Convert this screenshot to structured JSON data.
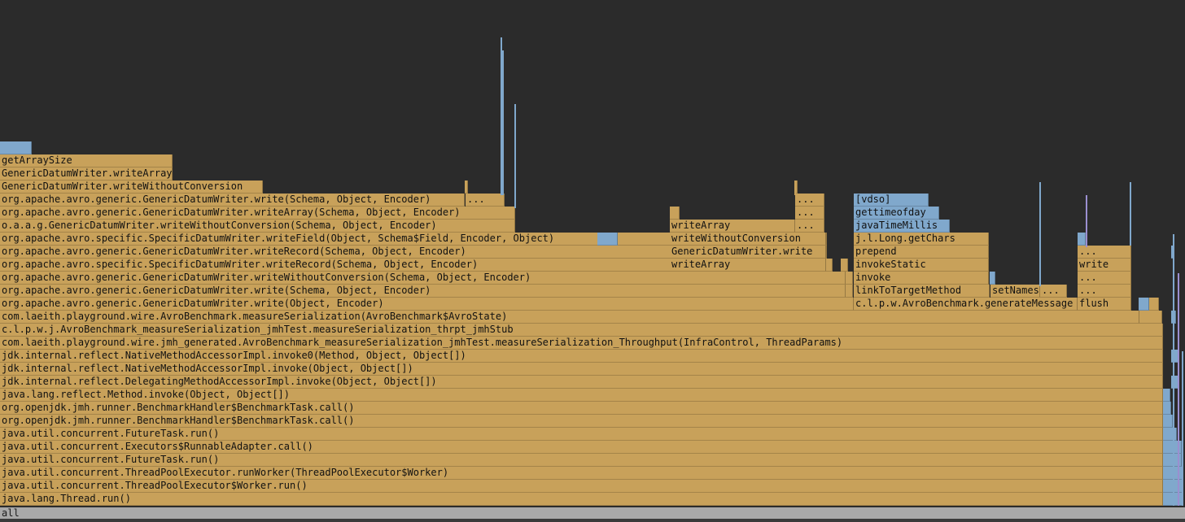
{
  "chart_data": {
    "type": "flamegraph",
    "root": {
      "name": "all"
    },
    "frames": [
      {
        "name": "java.lang.Thread.run()",
        "depth": 1,
        "start": 0.0,
        "width": 0.9815,
        "kind": "java"
      },
      {
        "name": "java.util.concurrent.ThreadPoolExecutor$Worker.run()",
        "depth": 2,
        "start": 0.0,
        "width": 0.9815,
        "kind": "java"
      },
      {
        "name": "java.util.concurrent.ThreadPoolExecutor.runWorker(ThreadPoolExecutor$Worker)",
        "depth": 3,
        "start": 0.0,
        "width": 0.9815,
        "kind": "java"
      },
      {
        "name": "java.util.concurrent.FutureTask.run()",
        "depth": 4,
        "start": 0.0,
        "width": 0.9815,
        "kind": "java"
      },
      {
        "name": "java.util.concurrent.Executors$RunnableAdapter.call()",
        "depth": 5,
        "start": 0.0,
        "width": 0.9815,
        "kind": "java"
      },
      {
        "name": "java.util.concurrent.FutureTask.run()",
        "depth": 6,
        "start": 0.0,
        "width": 0.9815,
        "kind": "java"
      },
      {
        "name": "org.openjdk.jmh.runner.BenchmarkHandler$BenchmarkTask.call()",
        "depth": 7,
        "start": 0.0,
        "width": 0.9815,
        "kind": "java"
      },
      {
        "name": "org.openjdk.jmh.runner.BenchmarkHandler$BenchmarkTask.call()",
        "depth": 8,
        "start": 0.0,
        "width": 0.9815,
        "kind": "java"
      },
      {
        "name": "java.lang.reflect.Method.invoke(Object, Object[])",
        "depth": 9,
        "start": 0.0,
        "width": 0.9815,
        "kind": "java"
      },
      {
        "name": "jdk.internal.reflect.DelegatingMethodAccessorImpl.invoke(Object, Object[])",
        "depth": 10,
        "start": 0.0,
        "width": 0.9815,
        "kind": "java"
      },
      {
        "name": "jdk.internal.reflect.NativeMethodAccessorImpl.invoke(Object, Object[])",
        "depth": 11,
        "start": 0.0,
        "width": 0.9815,
        "kind": "java"
      },
      {
        "name": "jdk.internal.reflect.NativeMethodAccessorImpl.invoke0(Method, Object, Object[])",
        "depth": 12,
        "start": 0.0,
        "width": 0.9815,
        "kind": "java"
      },
      {
        "name": "com.laeith.playground.wire.jmh_generated.AvroBenchmark_measureSerialization_jmhTest.measureSerialization_Throughput(InfraControl, ThreadParams)",
        "depth": 13,
        "start": 0.0,
        "width": 0.9815,
        "kind": "java"
      },
      {
        "name": "c.l.p.w.j.AvroBenchmark_measureSerialization_jmhTest.measureSerialization_thrpt_jmhStub",
        "depth": 14,
        "start": 0.0,
        "width": 0.9815,
        "kind": "java"
      },
      {
        "name": "com.laeith.playground.wire.AvroBenchmark.measureSerialization(AvroBenchmark$AvroState)",
        "depth": 15,
        "start": 0.0,
        "width": 0.9615,
        "kind": "java"
      },
      {
        "name": "org.apache.avro.generic.GenericDatumWriter.write(Object, Encoder)",
        "depth": 16,
        "start": 0.0,
        "width": 0.7205,
        "kind": "java"
      },
      {
        "name": "org.apache.avro.generic.GenericDatumWriter.write(Schema, Object, Encoder)",
        "depth": 17,
        "start": 0.0,
        "width": 0.7135,
        "kind": "java"
      },
      {
        "name": "org.apache.avro.generic.GenericDatumWriter.writeWithoutConversion(Schema, Object, Encoder)",
        "depth": 18,
        "start": 0.0,
        "width": 0.7135,
        "kind": "java"
      },
      {
        "name": "org.apache.avro.specific.SpecificDatumWriter.writeRecord(Schema, Object, Encoder)",
        "depth": 19,
        "start": 0.0,
        "width": 0.7025,
        "kind": "java"
      },
      {
        "name": "org.apache.avro.generic.GenericDatumWriter.writeRecord(Schema, Object, Encoder)",
        "depth": 20,
        "start": 0.0,
        "width": 0.6975,
        "kind": "java"
      },
      {
        "name": "org.apache.avro.specific.SpecificDatumWriter.writeField(Object, Schema$Field, Encoder, Object)",
        "depth": 21,
        "start": 0.0,
        "width": 0.6975,
        "kind": "java"
      },
      {
        "name": "o.a.a.g.GenericDatumWriter.writeWithoutConversion(Schema, Object, Encoder)",
        "depth": 22,
        "start": 0.0,
        "width": 0.435,
        "kind": "java"
      },
      {
        "name": "org.apache.avro.generic.GenericDatumWriter.writeArray(Schema, Object, Encoder)",
        "depth": 23,
        "start": 0.0,
        "width": 0.435,
        "kind": "java"
      },
      {
        "name": "org.apache.avro.generic.GenericDatumWriter.write(Schema, Object, Encoder)",
        "depth": 24,
        "start": 0.0,
        "width": 0.392,
        "kind": "java"
      },
      {
        "name": "...",
        "depth": 24,
        "start": 0.393,
        "width": 0.033,
        "kind": "java"
      },
      {
        "name": "GenericDatumWriter.writeWithoutConversion",
        "depth": 25,
        "start": 0.0,
        "width": 0.222,
        "kind": "java"
      },
      {
        "name": "",
        "depth": 25,
        "start": 0.392,
        "width": 0.003,
        "kind": "java"
      },
      {
        "name": "GenericDatumWriter.writeArray",
        "depth": 26,
        "start": 0.0,
        "width": 0.1455,
        "kind": "java"
      },
      {
        "name": "getArraySize",
        "depth": 27,
        "start": 0.0,
        "width": 0.1455,
        "kind": "java"
      },
      {
        "name": "",
        "depth": 28,
        "start": 0.0,
        "width": 0.027,
        "kind": "native"
      },
      {
        "name": "",
        "depth": 21,
        "start": 0.504,
        "width": 0.017,
        "kind": "native"
      },
      {
        "name": "writeArray",
        "depth": 22,
        "start": 0.565,
        "width": 0.106,
        "kind": "java"
      },
      {
        "name": "",
        "depth": 23,
        "start": 0.565,
        "width": 0.008,
        "kind": "java"
      },
      {
        "name": "writeArray",
        "depth": 19,
        "start": 0.565,
        "width": 0.132,
        "kind": "java"
      },
      {
        "name": "GenericDatumWriter.write",
        "depth": 20,
        "start": 0.565,
        "width": 0.132,
        "kind": "java"
      },
      {
        "name": "writeWithoutConversion",
        "depth": 21,
        "start": 0.565,
        "width": 0.132,
        "kind": "java"
      },
      {
        "name": "...",
        "depth": 22,
        "start": 0.671,
        "width": 0.025,
        "kind": "java"
      },
      {
        "name": "...",
        "depth": 23,
        "start": 0.671,
        "width": 0.025,
        "kind": "java"
      },
      {
        "name": "...",
        "depth": 24,
        "start": 0.671,
        "width": 0.025,
        "kind": "java"
      },
      {
        "name": "",
        "depth": 25,
        "start": 0.671,
        "width": 0.002,
        "kind": "java"
      },
      {
        "name": "",
        "depth": 16,
        "start": 0.7205,
        "width": 0.0045,
        "kind": "java"
      },
      {
        "name": "",
        "depth": 17,
        "start": 0.7135,
        "width": 0.0065,
        "kind": "java"
      },
      {
        "name": "",
        "depth": 18,
        "start": 0.7135,
        "width": 0.0065,
        "kind": "java"
      },
      {
        "name": "",
        "depth": 19,
        "start": 0.7095,
        "width": 0.006,
        "kind": "java"
      },
      {
        "name": "c.l.p.w.AvroBenchmark.generateMessage",
        "depth": 16,
        "start": 0.7205,
        "width": 0.189,
        "kind": "java"
      },
      {
        "name": "linkToTargetMethod",
        "depth": 17,
        "start": 0.7205,
        "width": 0.115,
        "kind": "java"
      },
      {
        "name": "setNames",
        "depth": 17,
        "start": 0.836,
        "width": 0.042,
        "kind": "java"
      },
      {
        "name": "...",
        "depth": 17,
        "start": 0.878,
        "width": 0.023,
        "kind": "java"
      },
      {
        "name": "invoke",
        "depth": 18,
        "start": 0.7205,
        "width": 0.114,
        "kind": "java"
      },
      {
        "name": "invokeStatic",
        "depth": 19,
        "start": 0.7205,
        "width": 0.114,
        "kind": "java"
      },
      {
        "name": "prepend",
        "depth": 20,
        "start": 0.7205,
        "width": 0.114,
        "kind": "java"
      },
      {
        "name": "j.l.Long.getChars",
        "depth": 21,
        "start": 0.7205,
        "width": 0.114,
        "kind": "java"
      },
      {
        "name": "javaTimeMillis",
        "depth": 22,
        "start": 0.7205,
        "width": 0.081,
        "kind": "native"
      },
      {
        "name": "gettimeofday",
        "depth": 23,
        "start": 0.7205,
        "width": 0.072,
        "kind": "native"
      },
      {
        "name": "[vdso]",
        "depth": 24,
        "start": 0.7205,
        "width": 0.063,
        "kind": "native"
      },
      {
        "name": "",
        "depth": 18,
        "start": 0.8355,
        "width": 0.005,
        "kind": "native"
      },
      {
        "name": "flush",
        "depth": 16,
        "start": 0.9095,
        "width": 0.0455,
        "kind": "java"
      },
      {
        "name": "...",
        "depth": 17,
        "start": 0.9095,
        "width": 0.0455,
        "kind": "java"
      },
      {
        "name": "...",
        "depth": 18,
        "start": 0.9095,
        "width": 0.0455,
        "kind": "java"
      },
      {
        "name": "write",
        "depth": 19,
        "start": 0.9095,
        "width": 0.0455,
        "kind": "java"
      },
      {
        "name": "...",
        "depth": 20,
        "start": 0.9095,
        "width": 0.0455,
        "kind": "java"
      },
      {
        "name": "",
        "depth": 21,
        "start": 0.9095,
        "width": 0.007,
        "kind": "native"
      },
      {
        "name": "",
        "depth": 16,
        "start": 0.961,
        "width": 0.009,
        "kind": "native"
      },
      {
        "name": "",
        "depth": 16,
        "start": 0.97,
        "width": 0.0085,
        "kind": "java"
      },
      {
        "name": "",
        "depth": 15,
        "start": 0.9615,
        "width": 0.0195,
        "kind": "java"
      },
      {
        "name": "",
        "depth": 1,
        "start": 0.9815,
        "width": 0.0165,
        "kind": "native"
      },
      {
        "name": "",
        "depth": 2,
        "start": 0.9815,
        "width": 0.0165,
        "kind": "native"
      },
      {
        "name": "",
        "depth": 3,
        "start": 0.9815,
        "width": 0.0165,
        "kind": "native"
      },
      {
        "name": "",
        "depth": 4,
        "start": 0.9815,
        "width": 0.0155,
        "kind": "native"
      },
      {
        "name": "",
        "depth": 5,
        "start": 0.9815,
        "width": 0.0155,
        "kind": "native"
      },
      {
        "name": "",
        "depth": 6,
        "start": 0.9815,
        "width": 0.012,
        "kind": "native"
      },
      {
        "name": "",
        "depth": 7,
        "start": 0.9815,
        "width": 0.0085,
        "kind": "native"
      },
      {
        "name": "",
        "depth": 8,
        "start": 0.9815,
        "width": 0.007,
        "kind": "native"
      },
      {
        "name": "",
        "depth": 9,
        "start": 0.9815,
        "width": 0.006,
        "kind": "native"
      },
      {
        "name": "",
        "depth": 10,
        "start": 0.988,
        "width": 0.006,
        "kind": "native"
      },
      {
        "name": "",
        "depth": 12,
        "start": 0.988,
        "width": 0.006,
        "kind": "native"
      },
      {
        "name": "",
        "depth": 15,
        "start": 0.988,
        "width": 0.004,
        "kind": "native"
      },
      {
        "name": "",
        "depth": 20,
        "start": 0.9885,
        "width": 0.003,
        "kind": "native"
      }
    ]
  }
}
